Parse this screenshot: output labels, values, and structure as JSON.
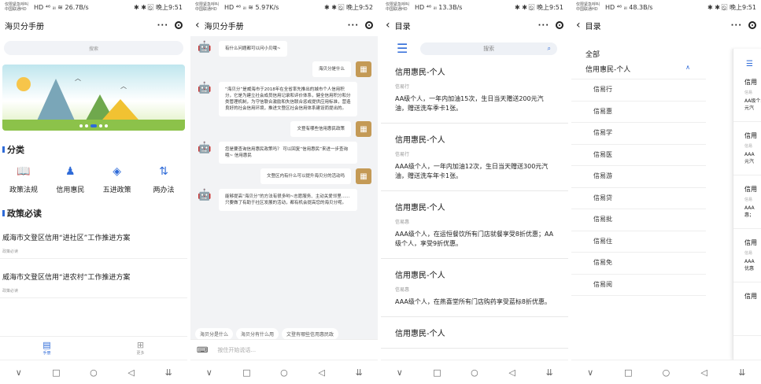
{
  "status_bars": [
    {
      "carrier": "仅限紧急呼叫 中国联通HD",
      "signal": "HD ⁴⁶ ᵢₗₗ ≋ 26.7B/s",
      "right": "✱ ✱ ⦸ ⃞ 晚上9:51"
    },
    {
      "carrier": "仅限紧急呼叫 中国联通HD",
      "signal": "HD ⁴⁶ ᵢₗₗ ≋ 5.97K/s",
      "right": "✱ ✱ ⦸ ⃞ 晚上9:52"
    },
    {
      "carrier": "仅限紧急呼叫 中国联通HD",
      "signal": "HD ⁴⁶ ᵢₗₗ 13.3B/s",
      "right": "✱ ✱ ⦸ ⃞ 晚上9:51"
    },
    {
      "carrier": "仅限紧急呼叫 中国联通HD",
      "signal": "HD ⁴⁶ ᵢₗₗ 48.3B/s",
      "right": "✱ ✱ ⦸ ⃞ 晚上9:51"
    }
  ],
  "capsule": {
    "more": "···",
    "close": "◎"
  },
  "system_nav": {
    "back": "∨",
    "home_square": "□",
    "home_circle": "○",
    "recent": "◁",
    "menu": "⇊"
  },
  "phone1": {
    "title": "海贝分手册",
    "search_placeholder": "搜索",
    "section_category": "分类",
    "categories": [
      {
        "label": "政策法规",
        "icon": "book-icon",
        "glyph": "📖"
      },
      {
        "label": "信用惠民",
        "icon": "user-icon",
        "glyph": "♟"
      },
      {
        "label": "五进政策",
        "icon": "layers-icon",
        "glyph": "◈"
      },
      {
        "label": "两办法",
        "icon": "sliders-icon",
        "glyph": "⇅"
      }
    ],
    "section_policy": "政策必读",
    "policies": [
      {
        "title": "威海市文登区信用“进社区”工作推进方案",
        "sub": "政策必读"
      },
      {
        "title": "威海市文登区信用“进农村”工作推进方案",
        "sub": "政策必读"
      }
    ],
    "tabs": [
      {
        "label": "手册",
        "icon": "handbook-icon",
        "glyph": "▤",
        "active": true
      },
      {
        "label": "更多",
        "icon": "grid-icon",
        "glyph": "⊞",
        "active": false
      }
    ]
  },
  "phone2": {
    "title": "海贝分手册",
    "messages": [
      {
        "from": "bot",
        "text": "有什么问题都可以问小贝哦~"
      },
      {
        "from": "user",
        "text": "海贝分是什么"
      },
      {
        "from": "bot",
        "text": "“海贝分”是威海市于2018年在全省率先推出的城市个人信用积分，它是为建立社会成员信用记录和评价体系，健全信用积分和分类管理机制，为守信联合激励和失信联合惩戒提供应用标准，营造良好的社会信用环境，推进文登区社会信用体系建设而提出的。"
      },
      {
        "from": "user",
        "text": "文登有哪些信用惠民政策"
      },
      {
        "from": "bot",
        "text": "您是要查询信用惠民政策吗？ 可以回复“信用惠民”来进一步查询哦~ 信用惠民"
      },
      {
        "from": "user",
        "text": "文登区内有什么可以提升海贝分的活动吗"
      },
      {
        "from": "bot",
        "text": "能够提高“海贝分”的方法有很多哟~志愿服务、主动关爱邻里......只要做了有助于社区发展的活动，都有机会提高您的海贝分呢。"
      }
    ],
    "quick_replies": [
      "海贝分是什么",
      "海贝分有什么用",
      "文登有哪些信用惠民政"
    ],
    "input_placeholder": "按住开始说话..."
  },
  "phone3": {
    "title": "目录",
    "search_placeholder": "搜索",
    "cards": [
      {
        "title": "信用惠民-个人",
        "sub": "信易行",
        "desc": "AA级个人，一年内加油15次，生日当天赠送200元汽油，赠送洗车季卡1张。"
      },
      {
        "title": "信用惠民-个人",
        "sub": "信易行",
        "desc": "AAA级个人，一年内加油12次，生日当天赠送300元汽油，赠送洗车年卡1张。"
      },
      {
        "title": "信用惠民-个人",
        "sub": "信易惠",
        "desc": "AAA级个人，在运恒餐饮所有门店就餐享受8折优惠；AA级个人，享受9折优惠。"
      },
      {
        "title": "信用惠民-个人",
        "sub": "信易惠",
        "desc": "AAA级个人，在燕喜堂所有门店购药享受蓝标8折优惠。"
      },
      {
        "title": "信用惠民-个人",
        "sub": "",
        "desc": ""
      }
    ]
  },
  "phone4": {
    "title": "目录",
    "all_label": "全部",
    "group_label": "信用惠民-个人",
    "items": [
      "信易行",
      "信易惠",
      "信易学",
      "信易医",
      "信易游",
      "信易贷",
      "信易批",
      "信易住",
      "信易免",
      "信易阅"
    ],
    "drawer_cards": [
      {
        "title": "信用",
        "sub": "信易",
        "desc": "AA级个人\n元汽"
      },
      {
        "title": "信用",
        "sub": "信易",
        "desc": "AAA\n元汽"
      },
      {
        "title": "信用",
        "sub": "信易",
        "desc": "AAA\n惠；"
      },
      {
        "title": "信用",
        "sub": "信易",
        "desc": "AAA\n优惠"
      },
      {
        "title": "信用",
        "sub": "",
        "desc": ""
      }
    ]
  }
}
